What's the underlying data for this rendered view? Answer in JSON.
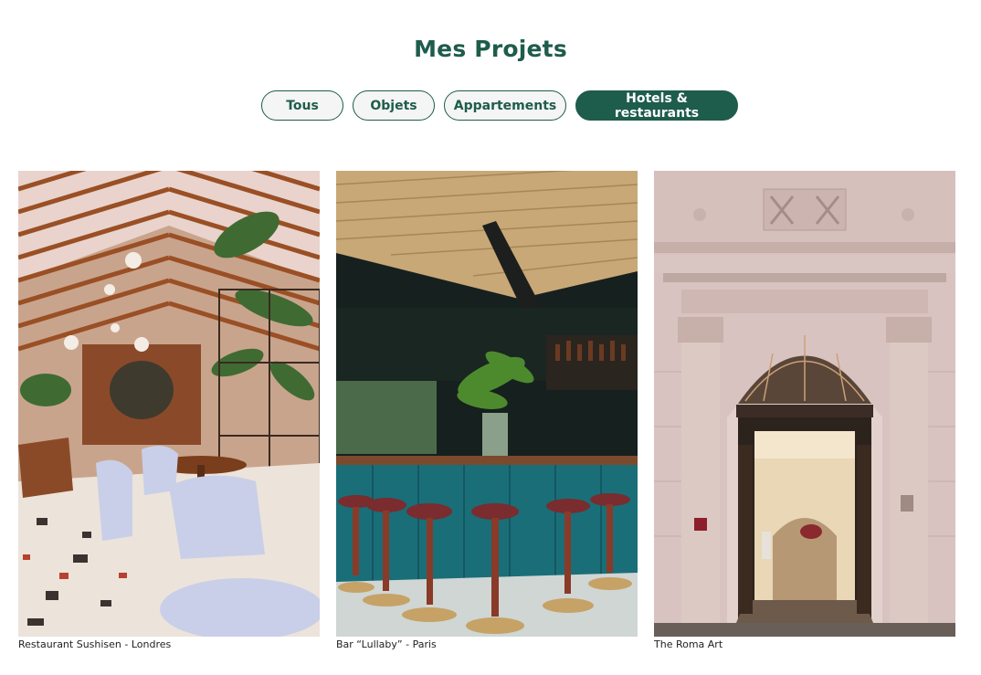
{
  "page": {
    "title": "Mes Projets"
  },
  "colors": {
    "accent": "#1e5c4b"
  },
  "filters": [
    {
      "label": "Tous",
      "active": false
    },
    {
      "label": "Objets",
      "active": false
    },
    {
      "label": "Appartements",
      "active": false
    },
    {
      "label": "Hotels & restaurants",
      "active": true
    }
  ],
  "projects": [
    {
      "caption": "Restaurant Sushisen - Londres",
      "image": "restaurant-greenhouse-photo"
    },
    {
      "caption": "Bar “Lullaby” - Paris",
      "image": "teal-bar-stools-photo"
    },
    {
      "caption": "The Roma Art",
      "image": "hotel-entrance-arch-photo"
    }
  ]
}
